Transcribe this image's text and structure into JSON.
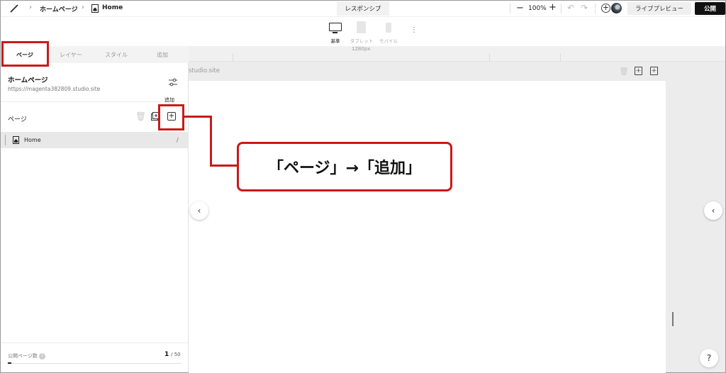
{
  "topbar": {
    "breadcrumb_root": "ホームページ",
    "breadcrumb_page": "Home",
    "responsive_label": "レスポンシブ",
    "zoom": "100%",
    "live_preview": "ライブプレビュー",
    "publish": "公開"
  },
  "devices": [
    {
      "label": "基準"
    },
    {
      "label": "タブレット"
    },
    {
      "label": "モバイル"
    }
  ],
  "ruler": {
    "width_label": "1280px"
  },
  "canvas": {
    "url_ghost": "studio.site"
  },
  "panel": {
    "tabs": [
      "ページ",
      "レイヤー",
      "スタイル",
      "追加"
    ],
    "site_title": "ホームページ",
    "site_url": "https://magenta382809.studio.site",
    "section_title": "ページ",
    "tooltip": "追加",
    "pages": [
      {
        "name": "Home",
        "path": "/"
      }
    ],
    "footer": {
      "label": "公開ページ数",
      "current": "1",
      "max": "/ 50"
    }
  },
  "annotation": {
    "callout": "「ページ」→「追加」",
    "color": "#c91a1a"
  }
}
